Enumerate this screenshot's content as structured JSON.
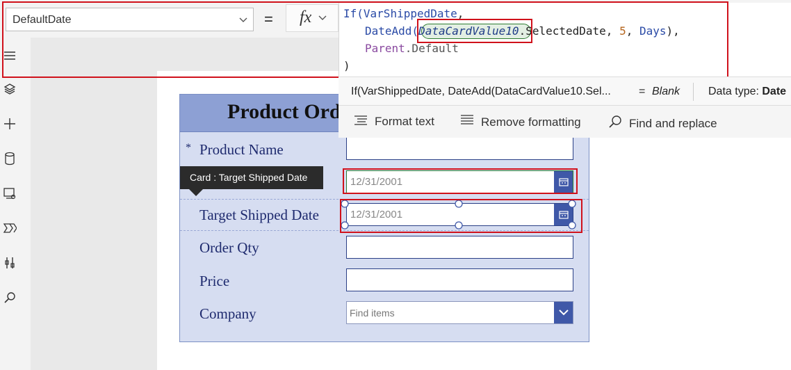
{
  "formula_bar": {
    "property": "DefaultDate",
    "equals": "=",
    "fx": "fx",
    "code": {
      "l1_fn": "If(",
      "l1_var": "VarShippedDate",
      "l1_comma": ",",
      "l2_fn": "DateAdd(",
      "l2_token": "DataCardValue10",
      "l2_rest_a": ".SelectedDate, ",
      "l2_num": "5",
      "l2_rest_b": ", ",
      "l2_days": "Days",
      "l2_close": "),",
      "l3_parent": "Parent",
      "l3_rest": ".Default",
      "l4": ")"
    },
    "result": {
      "expression": "If(VarShippedDate, DateAdd(DataCardValue10.Sel...",
      "equals": "=",
      "value": "Blank",
      "type_label": "Data type: ",
      "type_value": "Date"
    },
    "format": {
      "format_text": "Format text",
      "remove_formatting": "Remove formatting",
      "find_replace": "Find and replace"
    }
  },
  "form": {
    "title": "Product Order",
    "required_mark": "*",
    "fields": [
      {
        "label": "Product Name",
        "value": ""
      },
      {
        "label": "",
        "value": "12/31/2001"
      },
      {
        "label": "Target Shipped Date",
        "value": "12/31/2001"
      },
      {
        "label": "Order Qty",
        "value": ""
      },
      {
        "label": "Price",
        "value": ""
      },
      {
        "label": "Company",
        "placeholder": "Find items"
      }
    ]
  },
  "tooltip": "Card : Target Shipped Date",
  "rail": [
    "menu-icon",
    "layers-icon",
    "plus-icon",
    "database-icon",
    "media-icon",
    "power-automate-icon",
    "tools-icon",
    "search-icon"
  ],
  "colors": {
    "accent": "#3f58a8",
    "highlight": "#d0111b",
    "form_bg": "#d6ddf1",
    "header_bg": "#8da0d4"
  }
}
